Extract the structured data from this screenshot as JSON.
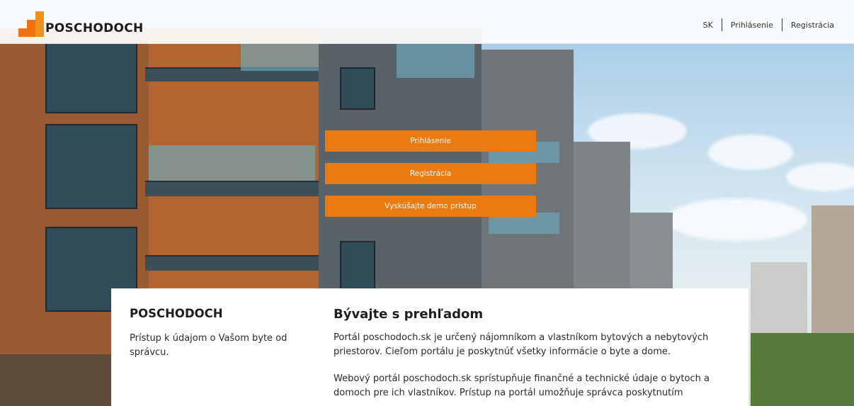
{
  "brand": {
    "name": "POSCHODOCH",
    "colors": {
      "accent": "#EB7A10",
      "logo_light": "#F0901F"
    }
  },
  "topnav": {
    "lang": "SK",
    "login": "Prihlásenie",
    "register": "Registrácia"
  },
  "hero": {
    "buttons": {
      "login": "Prihlásenie",
      "register": "Registrácia",
      "demo": "Vyskúšajte demo prístup"
    }
  },
  "info": {
    "left_title": "POSCHODOCH",
    "left_text": "Prístup k údajom o Vašom byte od správcu.",
    "right_title": "Bývajte s prehľadom",
    "paragraph1": "Portál poschodoch.sk je určený nájomníkom a vlastníkom bytových a nebytových priestorov. Cieľom portálu je poskytnúť všetky informácie o byte a dome.",
    "paragraph2": "Webový portál poschodoch.sk sprístupňuje finančné a technické údaje o bytoch a domoch pre ich vlastníkov. Prístup na portál umožňuje správca poskytnutím"
  }
}
